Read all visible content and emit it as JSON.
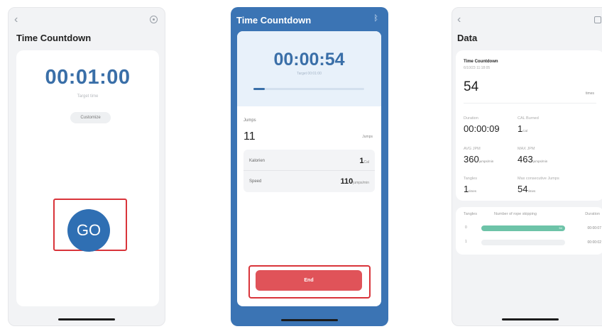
{
  "screen1": {
    "title": "Time Countdown",
    "timer": "00:01:00",
    "target_label": "Target time",
    "customize_label": "Customize",
    "go_label": "GO",
    "back_icon": "chevron-left-icon",
    "settings_icon": "gear-icon"
  },
  "screen2": {
    "title": "Time Countdown",
    "bluetooth_icon": "bluetooth-icon",
    "timer": "00:00:54",
    "target_sub": "Target 00:01:00",
    "progress": 0.1,
    "jumps_label": "Jumps",
    "jumps_value": "11",
    "jumps_unit": "Jumps",
    "stats": [
      {
        "label": "Kalorien",
        "value": "1",
        "unit": "Cal"
      },
      {
        "label": "Speed",
        "value": "110",
        "unit": "jumps/min"
      }
    ],
    "end_label": "End",
    "colors": {
      "header": "#3b74b4",
      "end_button": "#e05359",
      "highlight_frame": "#d9343a"
    }
  },
  "screen3": {
    "title": "Data",
    "share_icon": "share-icon",
    "summary_title": "Time Countdown",
    "summary_date": "6/10/23 11:18:05",
    "total_value": "54",
    "total_unit": "times",
    "stats": [
      {
        "label": "Duration",
        "value": "00:00:09",
        "unit": ""
      },
      {
        "label": "CAL Burned",
        "value": "1",
        "unit": "Cal"
      },
      {
        "label": "AVG JPM",
        "value": "360",
        "unit": "jumps/min"
      },
      {
        "label": "MAX JPM",
        "value": "463",
        "unit": "jumps/min"
      },
      {
        "label": "Tangles",
        "value": "1",
        "unit": "times"
      },
      {
        "label": "Max consecutive Jumps",
        "value": "54",
        "unit": "times"
      }
    ],
    "table_headers": [
      "Tangles",
      "Number of rope skipping",
      "Duration"
    ],
    "table_rows": [
      {
        "index": "0",
        "count": "54",
        "duration": "00:00:07"
      },
      {
        "index": "1",
        "count": "",
        "duration": "00:00:02"
      }
    ]
  }
}
